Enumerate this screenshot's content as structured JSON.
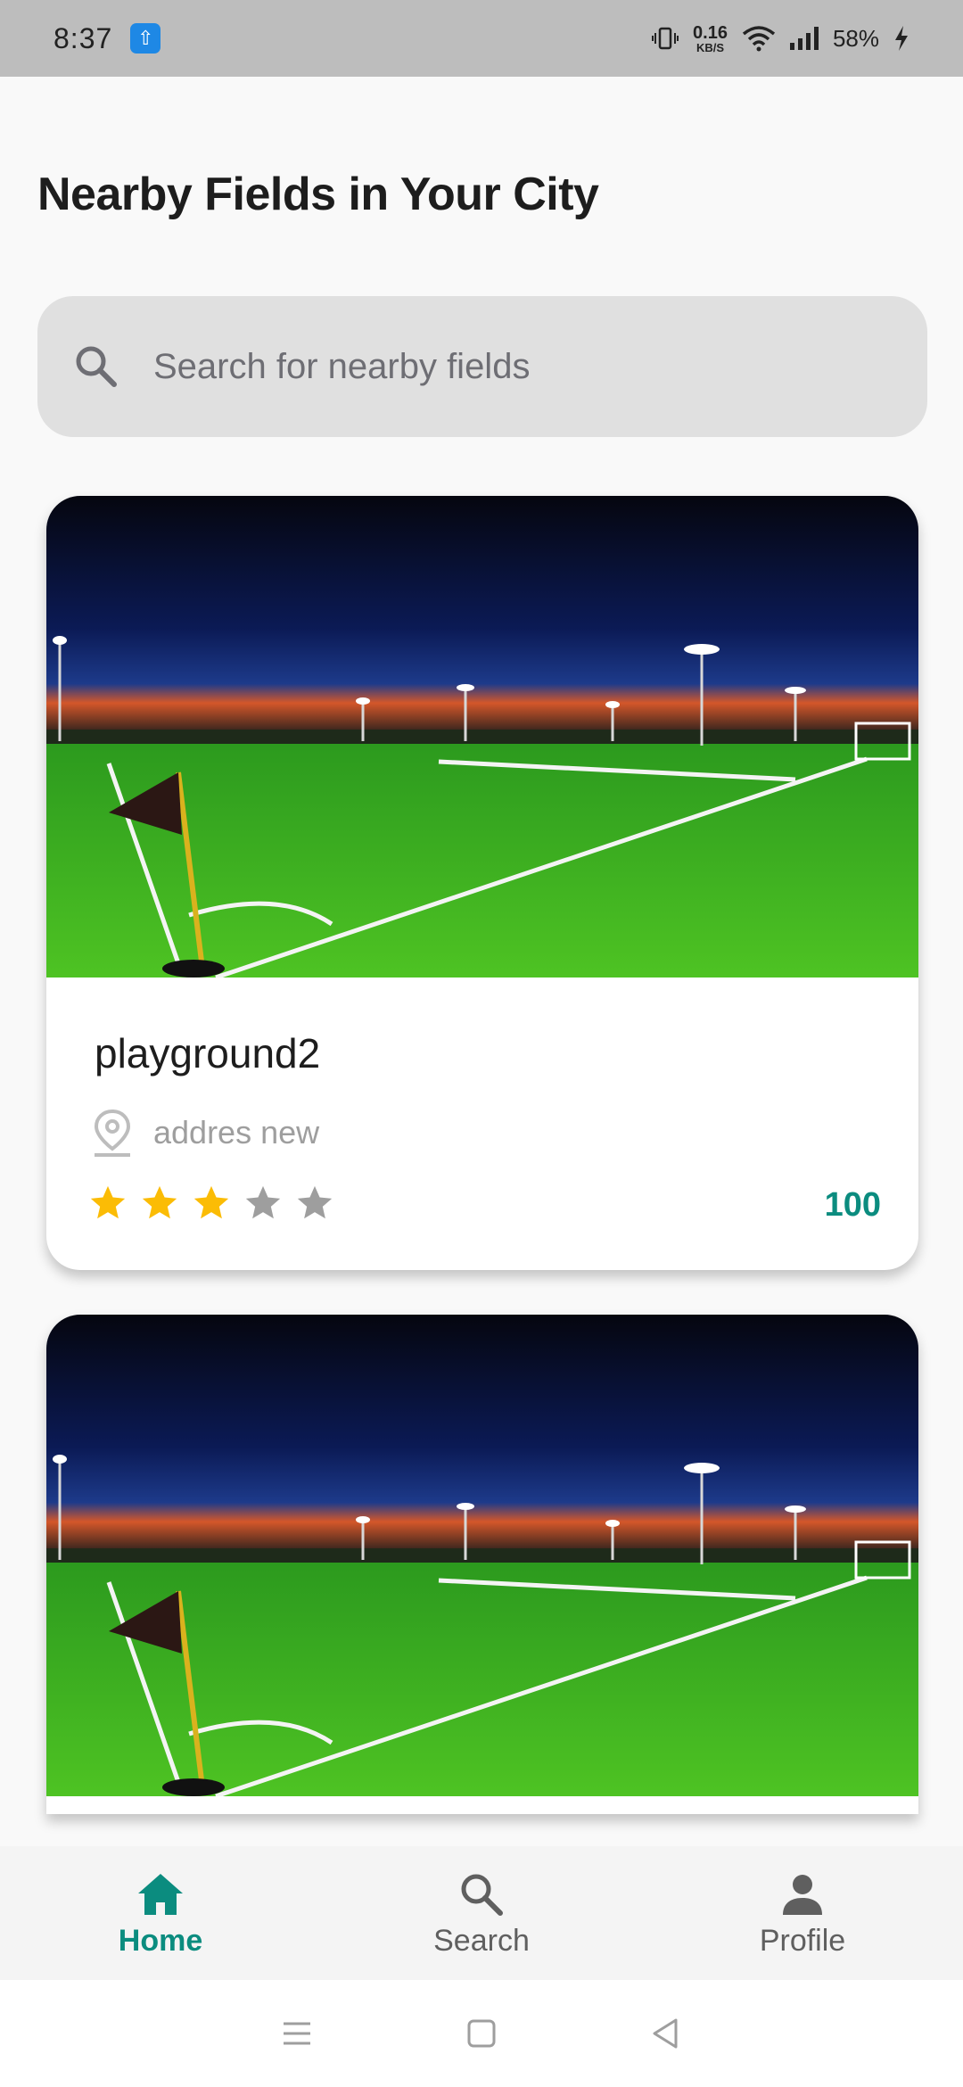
{
  "status_bar": {
    "time": "8:37",
    "usb_icon": "usb-icon",
    "net_speed_value": "0.16",
    "net_speed_unit": "KB/S",
    "battery": "58%"
  },
  "page": {
    "title": "Nearby Fields in Your City"
  },
  "search": {
    "placeholder": "Search for nearby fields"
  },
  "fields": [
    {
      "name": "playground2",
      "address": "addres new",
      "rating": 3,
      "max_rating": 5,
      "price": "100"
    },
    {
      "name": "",
      "address": "",
      "rating": null,
      "price": ""
    }
  ],
  "bottom_nav": {
    "items": [
      {
        "label": "Home",
        "icon": "home-icon",
        "active": true
      },
      {
        "label": "Search",
        "icon": "search-icon",
        "active": false
      },
      {
        "label": "Profile",
        "icon": "person-icon",
        "active": false
      }
    ]
  },
  "colors": {
    "accent": "#0b8c7f",
    "star_filled": "#fbbc05",
    "star_empty": "#9e9e9e",
    "search_bg": "#e0e0e0"
  }
}
